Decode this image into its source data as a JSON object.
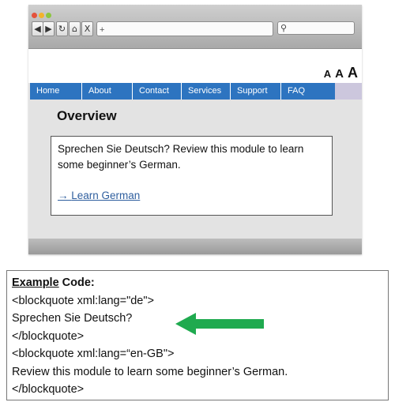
{
  "browser": {
    "traffic_lights": [
      "#e4523c",
      "#f3b32b",
      "#8cc63f"
    ],
    "nav_buttons": [
      {
        "name": "back-button",
        "glyph": "◀"
      },
      {
        "name": "forward-button",
        "glyph": "▶"
      },
      {
        "name": "reload-button",
        "glyph": "↻"
      },
      {
        "name": "home-button",
        "glyph": "⌂"
      },
      {
        "name": "stop-button",
        "glyph": "X"
      },
      {
        "name": "new-tab-button",
        "glyph": "+"
      }
    ],
    "search_icon": "⚲",
    "address_value": "",
    "text_size_controls": [
      "A",
      "A",
      "A"
    ]
  },
  "site": {
    "nav": [
      "Home",
      "About",
      "Contact",
      "Services",
      "Support",
      "FAQ"
    ],
    "nav_color": "#2d74c0",
    "page_title": "Overview",
    "module_text": "Sprechen Sie Deutsch? Review this module to learn some beginner’s German.",
    "link_arrow": "→",
    "link_label": "Learn German"
  },
  "example": {
    "heading_emph": "Example",
    "heading_rest": " Code:",
    "lines": [
      "<blockquote xml:lang=\"de\">",
      "Sprechen Sie Deutsch?",
      "</blockquote>",
      "<blockquote xml:lang=“en-GB\">",
      "Review this module to learn some beginner’s German.",
      "</blockquote>"
    ],
    "arrow_color": "#1faa4f"
  }
}
